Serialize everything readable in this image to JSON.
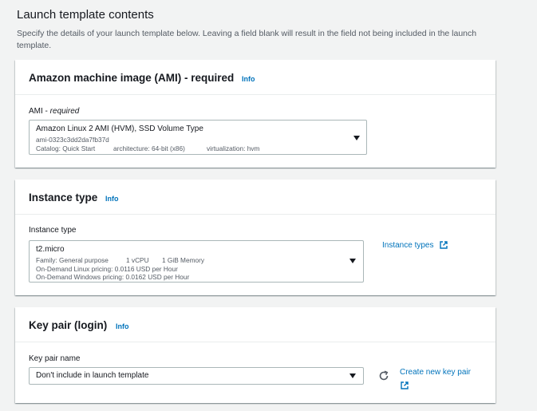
{
  "page": {
    "title": "Launch template contents",
    "description": "Specify the details of your launch template below. Leaving a field blank will result in the field not being included in the launch template."
  },
  "ami_panel": {
    "title": "Amazon machine image (AMI) - required",
    "info": "Info",
    "field_label": "AMI - ",
    "field_label_emph": "required",
    "selected_name": "Amazon Linux 2 AMI (HVM), SSD Volume Type",
    "ami_id": "ami-0323c3dd2da7fb37d",
    "catalog": "Catalog: Quick Start",
    "architecture": "architecture: 64-bit (x86)",
    "virtualization": "virtualization: hvm"
  },
  "instance_panel": {
    "title": "Instance type",
    "info": "Info",
    "field_label": "Instance type",
    "selected": "t2.micro",
    "family": "Family: General purpose",
    "vcpu": "1 vCPU",
    "memory": "1 GiB Memory",
    "linux_pricing": "On-Demand Linux pricing: 0.0116 USD per Hour",
    "windows_pricing": "On-Demand Windows pricing: 0.0162 USD per Hour",
    "types_link": "Instance types"
  },
  "keypair_panel": {
    "title": "Key pair (login)",
    "info": "Info",
    "field_label": "Key pair name",
    "selected": "Don't include in launch template",
    "create_link": "Create new key pair"
  },
  "colors": {
    "link": "#0073bb",
    "border": "#aab7b8",
    "background": "#f2f3f3"
  }
}
